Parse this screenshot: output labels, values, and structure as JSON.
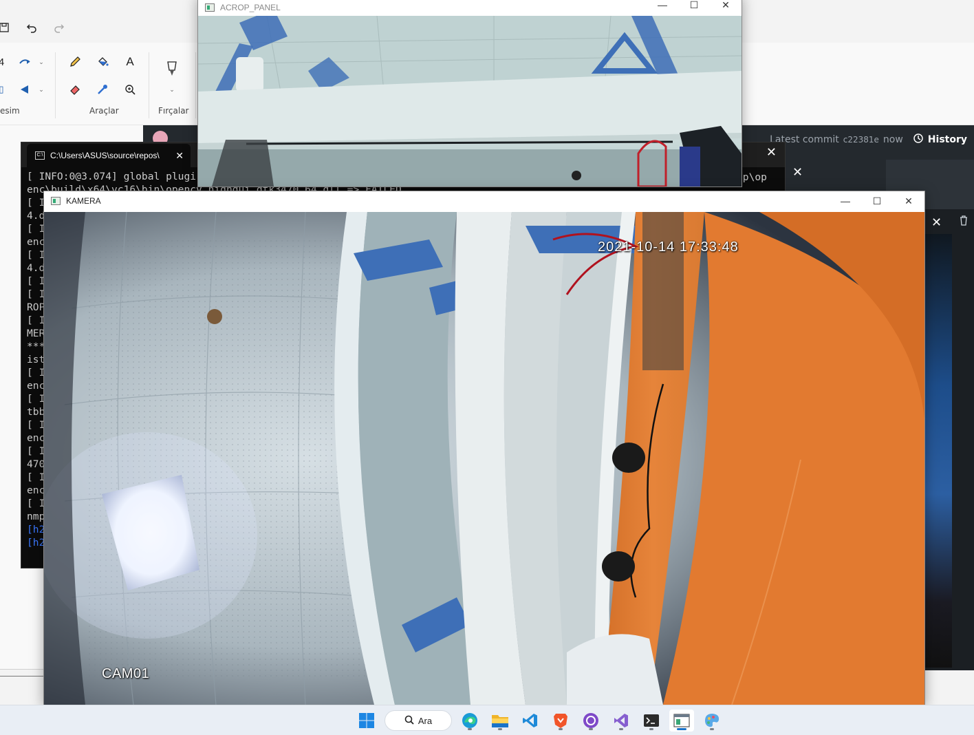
{
  "paint": {
    "group_left_label": "esim",
    "group_tools_label": "Araçlar",
    "group_brushes_label": "Fırçalar",
    "tools": {
      "text_glyph": "A"
    }
  },
  "github": {
    "latest_commit_label": "Latest commit",
    "commit_sha": "c22381e",
    "commit_time": "now",
    "history_label": "History"
  },
  "console": {
    "tab_title": "C:\\Users\\ASUS\\source\\repos\\",
    "lines": [
      "[ INFO:0@3.074] global plugi",
      "enc\\build\\x64\\vc16\\bin\\opencv_highgui_gtk3470_64.dll => FAILED",
      "[ I",
      "4.d",
      "[ I",
      "enc",
      "[ I",
      "4.d",
      "[ I",
      "[ I",
      "ROP",
      "[ I",
      "MER",
      "***",
      "ist",
      "[ I",
      "enc",
      "[ I",
      "tbb",
      "[ I",
      "enc",
      "[ I",
      "470",
      "[ I",
      "enc",
      "[ I",
      "nmp"
    ],
    "blue_lines": [
      "[h2",
      "[h2"
    ],
    "right_fragment": "op\\op"
  },
  "acrop_window": {
    "title": "ACROP_PANEL"
  },
  "kamera_window": {
    "title": "KAMERA",
    "timestamp": "2021-10-14 17:33:48",
    "camera_id": "CAM01"
  },
  "taskbar": {
    "search_label": "Ara",
    "apps": [
      "start",
      "search",
      "edge",
      "file-explorer",
      "vscode",
      "brave",
      "github-desktop",
      "visual-studio",
      "terminal",
      "opencv-window",
      "paint"
    ]
  },
  "colors": {
    "console_bg": "#0c0c0c",
    "github_bg": "#24292e",
    "camera_orange": "#e0782c",
    "camera_blue_frame": "#3e6fb7"
  }
}
